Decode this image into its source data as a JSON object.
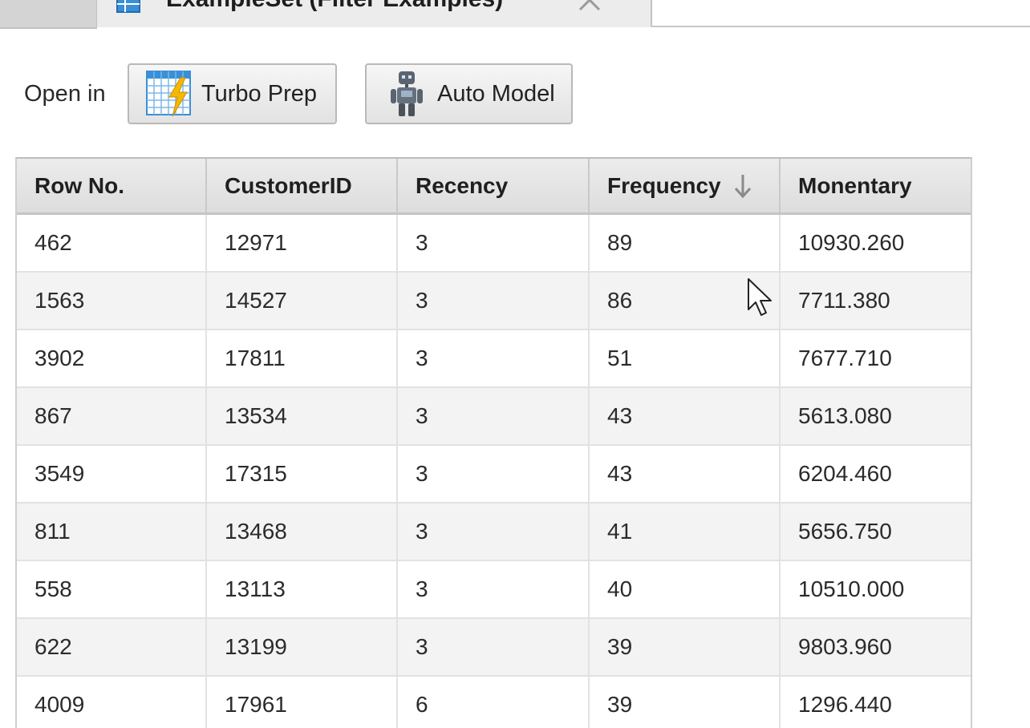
{
  "tabs": {
    "active_title": "ExampleSet (Filter Examples)",
    "close_icon": "close-icon",
    "table_icon": "table-icon"
  },
  "toolbar": {
    "open_in_label": "Open in",
    "turbo_prep_label": "Turbo Prep",
    "turbo_prep_icon": "turbo-prep-icon",
    "auto_model_label": "Auto Model",
    "auto_model_icon": "robot-icon"
  },
  "table": {
    "columns": [
      "Row No.",
      "CustomerID",
      "Recency",
      "Frequency",
      "Monentary"
    ],
    "sort": {
      "column": "Frequency",
      "direction": "descending",
      "icon": "sort-down-arrow-icon"
    },
    "rows": [
      [
        "462",
        "12971",
        "3",
        "89",
        "10930.260"
      ],
      [
        "1563",
        "14527",
        "3",
        "86",
        "7711.380"
      ],
      [
        "3902",
        "17811",
        "3",
        "51",
        "7677.710"
      ],
      [
        "867",
        "13534",
        "3",
        "43",
        "5613.080"
      ],
      [
        "3549",
        "17315",
        "3",
        "43",
        "6204.460"
      ],
      [
        "811",
        "13468",
        "3",
        "41",
        "5656.750"
      ],
      [
        "558",
        "13113",
        "3",
        "40",
        "10510.000"
      ],
      [
        "622",
        "13199",
        "3",
        "39",
        "9803.960"
      ],
      [
        "4009",
        "17961",
        "6",
        "39",
        "1296.440"
      ]
    ]
  },
  "colors": {
    "header_bg": "#e4e4e4",
    "row_alt_bg": "#f3f3f3",
    "turbo_prep_accent": "#f5b800",
    "turbo_prep_grid": "#3a8fd6"
  }
}
